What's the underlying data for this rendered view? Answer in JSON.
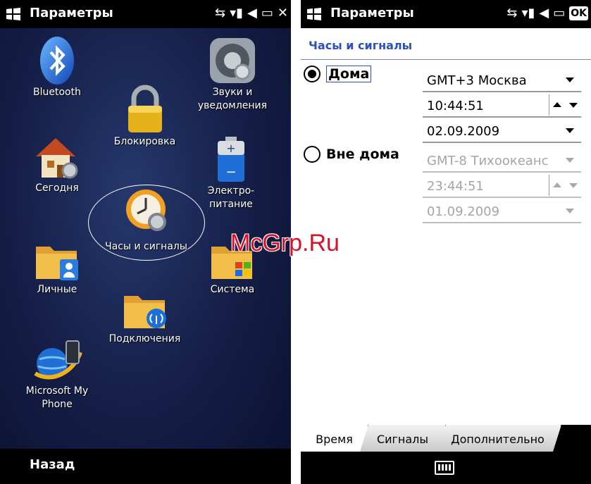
{
  "left": {
    "status_title": "Параметры",
    "tiles": [
      {
        "label": "Bluetooth"
      },
      {
        "label": "Звуки и\nуведомления"
      },
      {
        "label": "Блокировка"
      },
      {
        "label": "Сегодня"
      },
      {
        "label": "Электро-\nпитание"
      },
      {
        "label": "Часы и сигналы"
      },
      {
        "label": "Личные"
      },
      {
        "label": "Система"
      },
      {
        "label": "Подключения"
      },
      {
        "label": "Microsoft My\nPhone"
      }
    ],
    "softkey_left": "Назад"
  },
  "right": {
    "status_title": "Параметры",
    "header": "Часы и сигналы",
    "home": {
      "label": "Дома",
      "selected": true,
      "timezone": "GMT+3 Москва",
      "time": "10:44:51",
      "date": "02.09.2009"
    },
    "away": {
      "label": "Вне дома",
      "selected": false,
      "timezone": "GMT-8 Тихоокеанс",
      "time": "23:44:51",
      "date": "01.09.2009"
    },
    "tabs": [
      "Время",
      "Сигналы",
      "Дополнительно"
    ],
    "active_tab": "Время"
  },
  "watermark": "McGrp.Ru",
  "colors": {
    "accent": "#2b52b8",
    "background_left": "#141d45",
    "watermark": "#d8102a"
  }
}
